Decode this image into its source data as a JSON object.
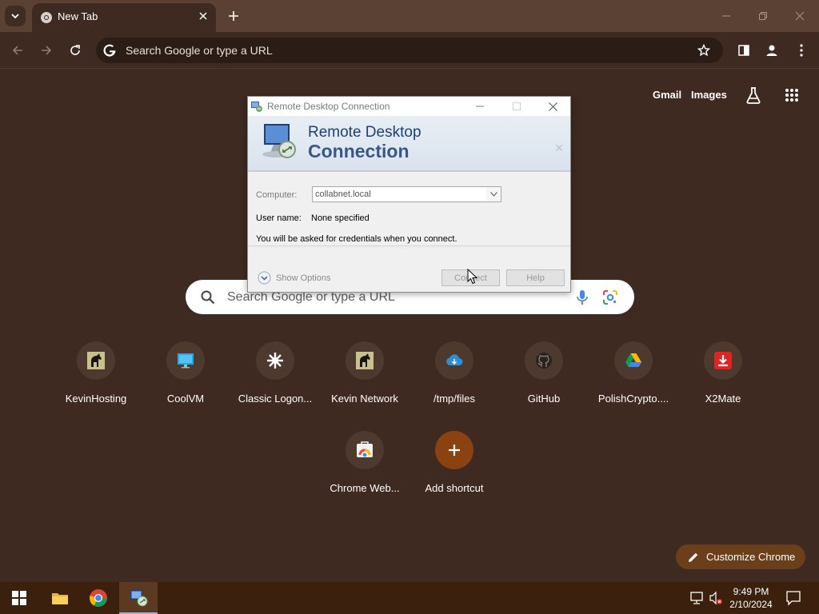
{
  "browser": {
    "tab_title": "New Tab",
    "omnibox_placeholder": "Search Google or type a URL"
  },
  "ntp": {
    "gmail_label": "Gmail",
    "images_label": "Images",
    "search_placeholder": "Search Google or type a URL",
    "shortcuts": [
      {
        "label": "KevinHosting",
        "icon": "horse-icon"
      },
      {
        "label": "CoolVM",
        "icon": "monitor-icon"
      },
      {
        "label": "Classic Logon...",
        "icon": "star-burst-icon"
      },
      {
        "label": "Kevin Network",
        "icon": "horse-icon"
      },
      {
        "label": "/tmp/files",
        "icon": "cloud-icon"
      },
      {
        "label": "GitHub",
        "icon": "github-icon"
      },
      {
        "label": "PolishCrypto....",
        "icon": "drive-icon"
      },
      {
        "label": "X2Mate",
        "icon": "download-icon"
      },
      {
        "label": "Chrome Web...",
        "icon": "web-store-icon"
      },
      {
        "label": "Add shortcut",
        "icon": "plus-icon"
      }
    ],
    "customize_label": "Customize Chrome"
  },
  "rdp": {
    "window_title": "Remote Desktop Connection",
    "banner_line1": "Remote Desktop",
    "banner_line2": "Connection",
    "computer_label": "Computer:",
    "computer_value": "collabnet.local",
    "username_label": "User name:",
    "username_value": "None specified",
    "credentials_note": "You will be asked for credentials when you connect.",
    "show_options_label": "Show Options",
    "connect_label": "Connect",
    "help_label": "Help"
  },
  "taskbar": {
    "time": "9:49 PM",
    "date": "2/10/2024"
  },
  "colors": {
    "tabstrip": "#5a4133",
    "page_background": "#3e2a20",
    "taskbar": "#3b200d",
    "customize_button": "#6b3f1a",
    "add_shortcut_accent": "#8a4310"
  }
}
